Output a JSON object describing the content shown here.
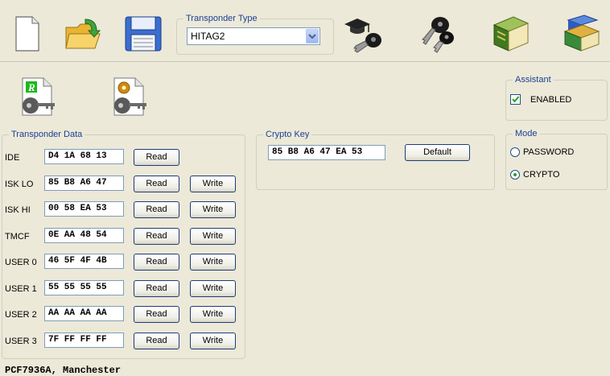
{
  "toolbar": {
    "transponder_type_label": "Transponder Type",
    "transponder_type_value": "HITAG2"
  },
  "assistant": {
    "title": "Assistant",
    "enabled_label": "ENABLED",
    "enabled_checked": true
  },
  "mode": {
    "title": "Mode",
    "options": [
      "PASSWORD",
      "CRYPTO"
    ],
    "selected": "CRYPTO"
  },
  "crypto_key": {
    "title": "Crypto Key",
    "value": "85 B8 A6 47 EA 53",
    "default_label": "Default"
  },
  "transponder_data": {
    "title": "Transponder Data",
    "read_label": "Read",
    "write_label": "Write",
    "rows": [
      {
        "label": "IDE",
        "value": "D4 1A 68 13"
      },
      {
        "label": "ISK LO",
        "value": "85 B8 A6 47"
      },
      {
        "label": "ISK HI",
        "value": "00 58 EA 53"
      },
      {
        "label": "TMCF",
        "value": "0E AA 48 54"
      },
      {
        "label": "USER 0",
        "value": "46 5F 4F 4B"
      },
      {
        "label": "USER 1",
        "value": "55 55 55 55"
      },
      {
        "label": "USER 2",
        "value": "AA AA AA AA"
      },
      {
        "label": "USER 3",
        "value": "7F FF FF FF"
      }
    ]
  },
  "status": "PCF7936A, Manchester",
  "colors": {
    "background": "#ece9d8",
    "group_title": "#1c3f96",
    "button_border": "#1f3b7a"
  },
  "icons": [
    "new-file-icon",
    "open-folder-icon",
    "save-disk-icon",
    "graduation-key-icon",
    "car-keys-icon",
    "book-icon",
    "books-icon",
    "read-key-file-icon",
    "settings-key-file-icon"
  ]
}
